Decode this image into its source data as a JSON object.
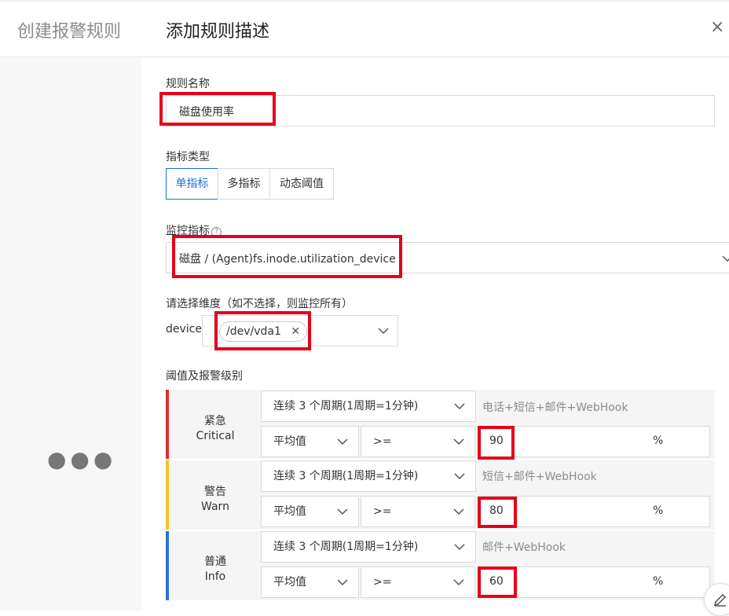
{
  "header": {
    "left_title": "创建报警规则",
    "main_title": "添加规则描述",
    "close_glyph": "×"
  },
  "left_panel": {
    "dots": "●●●"
  },
  "rule_name": {
    "label": "规则名称",
    "value": "磁盘使用率"
  },
  "metric_type": {
    "label": "指标类型",
    "options": [
      "单指标",
      "多指标",
      "动态阈值"
    ],
    "selected": "单指标"
  },
  "monitor_metric": {
    "label": "监控指标",
    "help_icon": "?",
    "value": "磁盘 / (Agent)fs.inode.utilization_device"
  },
  "dimension": {
    "label": "请选择维度（如不选择，则监控所有）",
    "key": "device:",
    "tag": "/dev/vda1"
  },
  "threshold": {
    "label": "阈值及报警级别",
    "levels": [
      {
        "name_cn": "紧急",
        "name_en": "Critical",
        "color": "#d9302c",
        "period": "连续 3 个周期(1周期=1分钟)",
        "notify": "电话+短信+邮件+WebHook",
        "stat": "平均值",
        "op": ">=",
        "value": "90",
        "unit": "%"
      },
      {
        "name_cn": "警告",
        "name_en": "Warn",
        "color": "#f5c32c",
        "period": "连续 3 个周期(1周期=1分钟)",
        "notify": "短信+邮件+WebHook",
        "stat": "平均值",
        "op": ">=",
        "value": "80",
        "unit": "%"
      },
      {
        "name_cn": "普通",
        "name_en": "Info",
        "color": "#2f6fe0",
        "period": "连续 3 个周期(1周期=1分钟)",
        "notify": "邮件+WebHook",
        "stat": "平均值",
        "op": ">=",
        "value": "60",
        "unit": "%"
      }
    ]
  },
  "colors": {
    "accent": "#1e6fd9",
    "highlight": "#e5001b"
  }
}
